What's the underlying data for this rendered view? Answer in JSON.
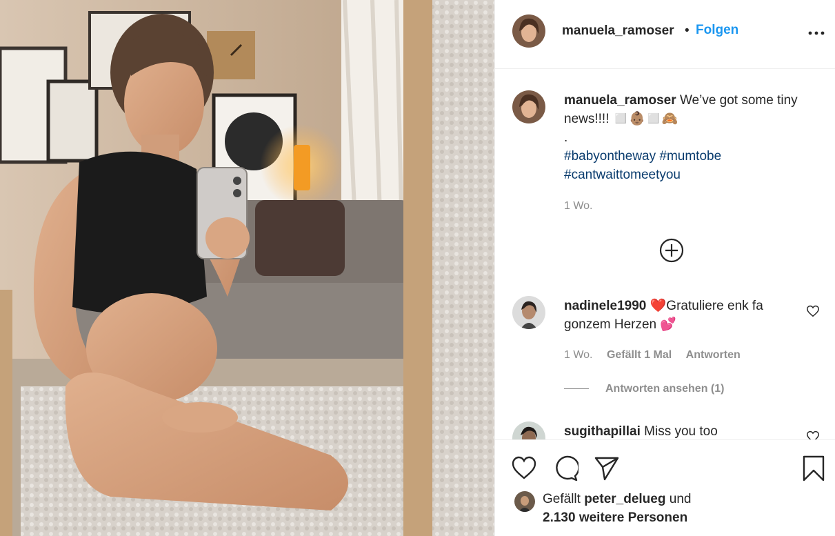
{
  "post": {
    "author": "manuela_ramoser",
    "separator": "•",
    "follow_label": "Folgen",
    "caption_text": "We’ve got some tiny news!!!!",
    "caption_emoji": "◻️👶🏽◻️🙈",
    "caption_dot": ".",
    "hashtags": [
      "#babyontheway",
      "#mumtobe",
      "#cantwaittomeetyou"
    ],
    "time": "1 Wo."
  },
  "comments": [
    {
      "user": "nadinele1990",
      "text_emoji_start": "❤️",
      "text": "Gratuliere enk fa gonzem Herzen",
      "text_emoji_end": "💕",
      "time": "1 Wo.",
      "likes": "Gefällt 1 Mal",
      "reply": "Antworten",
      "view_replies": "Antworten ansehen (1)"
    },
    {
      "user": "sugithapillai",
      "text": "Miss you too"
    }
  ],
  "likes_summary": {
    "prefix": "Gefällt",
    "user": "peter_delueg",
    "and": "und",
    "count_text": "2.130 weitere Personen"
  },
  "icons": {
    "more": "more-horizontal-icon",
    "load_more": "plus-circle-icon",
    "like": "heart-icon",
    "comment": "comment-icon",
    "share": "paper-plane-icon",
    "save": "bookmark-icon"
  },
  "colors": {
    "follow": "#1a96f0",
    "hashtag": "#0a3c6e",
    "muted": "#8e8e8e",
    "text": "#262626",
    "heart_red": "#e0282e"
  }
}
